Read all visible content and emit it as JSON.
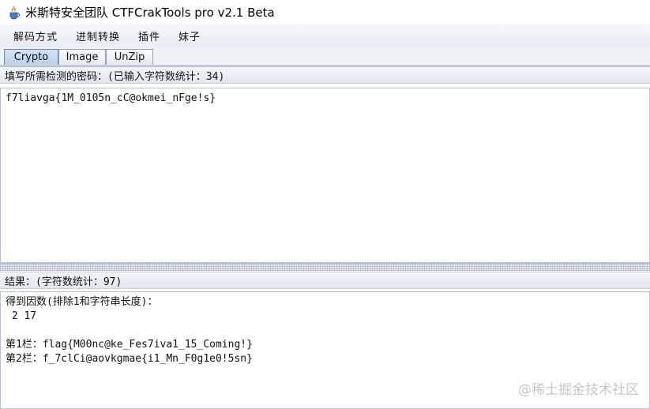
{
  "window": {
    "title": "米斯特安全团队 CTFCrakTools pro v2.1 Beta",
    "icon": "java-cup-icon"
  },
  "menu": [
    "解码方式",
    "进制转换",
    "插件",
    "妹子"
  ],
  "tabs": [
    {
      "label": "Crypto",
      "active": true
    },
    {
      "label": "Image",
      "active": false
    },
    {
      "label": "UnZip",
      "active": false
    }
  ],
  "input": {
    "label": "填写所需检测的密码：(已输入字符数统计：34)",
    "value": "f7liavga{1M_0105n_cC@okmei_nFge!s}"
  },
  "output": {
    "label": "结果：(字符数统计：97)",
    "lines": [
      "得到因数(排除1和字符串长度)：",
      " 2 17",
      "",
      "第1栏：flag{M00nc@ke_Fes7iva1_15_Coming!}",
      "第2栏：f_7clCi@aovkgmae{i1_Mn_F0g1e0!5sn}"
    ]
  },
  "watermark": "@稀土掘金技术社区"
}
